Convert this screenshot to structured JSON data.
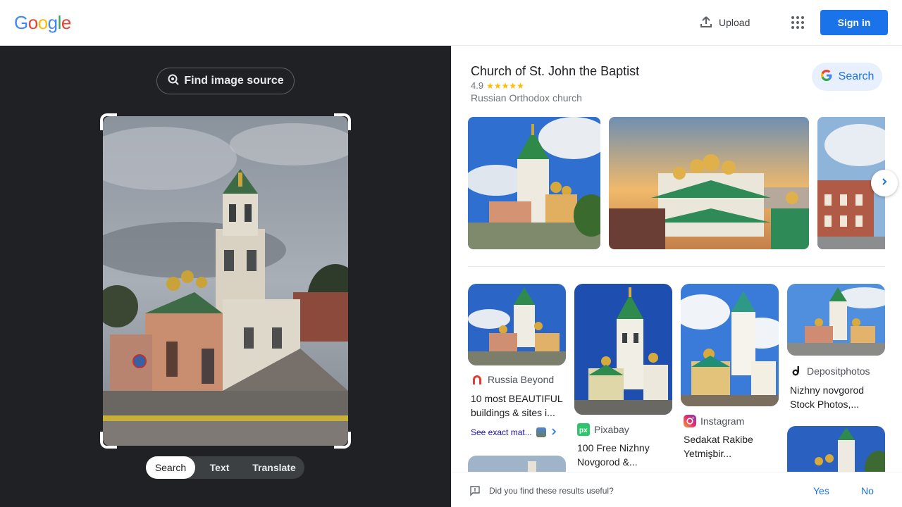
{
  "header": {
    "logo_letters": [
      {
        "ch": "G",
        "color": "#4285f4"
      },
      {
        "ch": "o",
        "color": "#ea4335"
      },
      {
        "ch": "o",
        "color": "#fbbc05"
      },
      {
        "ch": "g",
        "color": "#4285f4"
      },
      {
        "ch": "l",
        "color": "#34a853"
      },
      {
        "ch": "e",
        "color": "#ea4335"
      }
    ],
    "upload_label": "Upload",
    "apps_icon": "apps-grid-icon",
    "signin_label": "Sign in"
  },
  "lens": {
    "find_source_label": "Find image source",
    "modes": [
      "Search",
      "Text",
      "Translate"
    ],
    "active_mode": "Search"
  },
  "knowledge": {
    "title": "Church of St. John the Baptist",
    "rating": "4.9",
    "stars": "★★★★★",
    "subtitle": "Russian Orthodox church",
    "search_label": "Search"
  },
  "results": [
    {
      "source": "Russia Beyond",
      "title": "10 most BEAUTIFUL buildings & sites i...",
      "exact_label": "See exact mat..."
    },
    {
      "source": "Pixabay",
      "title": "100 Free Nizhny Novgorod &..."
    },
    {
      "source": "Instagram",
      "title": "Sedakat Rakibe Yetmişbir..."
    },
    {
      "source": "Depositphotos",
      "title": "Nizhny novgorod Stock Photos,..."
    }
  ],
  "feedback": {
    "question": "Did you find these results useful?",
    "yes": "Yes",
    "no": "No"
  },
  "colors": {
    "accent": "#1a73e8",
    "dark_panel": "#202124",
    "star": "#fbbc04"
  }
}
